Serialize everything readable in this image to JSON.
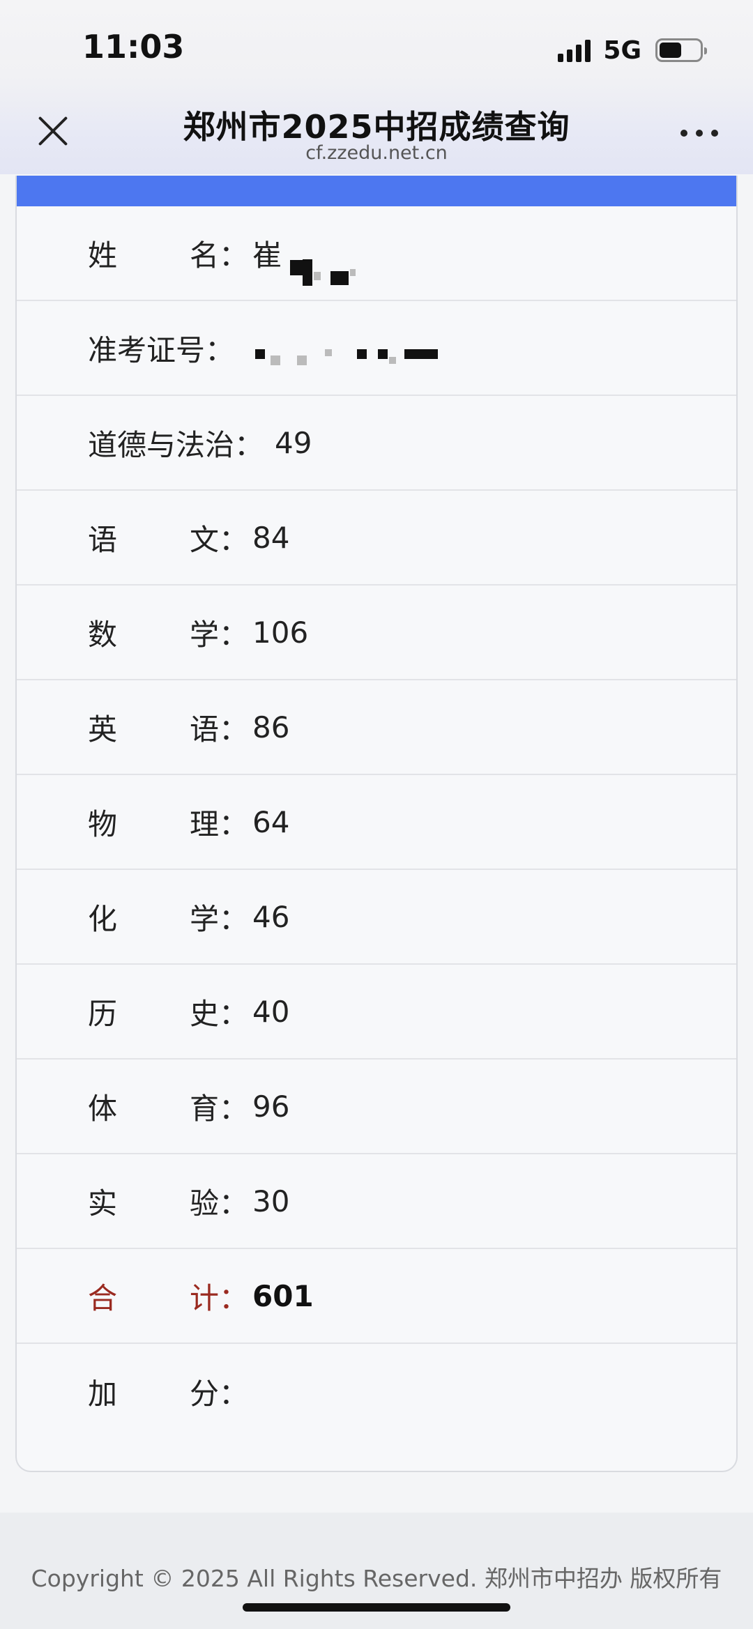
{
  "status_bar": {
    "time": "11:03",
    "network": "5G",
    "battery_level": 0.55
  },
  "nav": {
    "title": "郑州市2025中招成绩查询",
    "url": "cf.zzedu.net.cn"
  },
  "colors": {
    "accent_bar": "#4d77f0",
    "total_label": "#9a2a20"
  },
  "rows": [
    {
      "label_left": "姓",
      "label_right": "名：",
      "value": "崔"
    },
    {
      "label": "准考证号：",
      "value": ""
    },
    {
      "label": "道德与法治：",
      "value": "49"
    },
    {
      "label_left": "语",
      "label_right": "文：",
      "value": "84"
    },
    {
      "label_left": "数",
      "label_right": "学：",
      "value": "106"
    },
    {
      "label_left": "英",
      "label_right": "语：",
      "value": "86"
    },
    {
      "label_left": "物",
      "label_right": "理：",
      "value": "64"
    },
    {
      "label_left": "化",
      "label_right": "学：",
      "value": "46"
    },
    {
      "label_left": "历",
      "label_right": "史：",
      "value": "40"
    },
    {
      "label_left": "体",
      "label_right": "育：",
      "value": "96"
    },
    {
      "label_left": "实",
      "label_right": "验：",
      "value": "30"
    },
    {
      "label_left": "合",
      "label_right": "计：",
      "value": "601"
    },
    {
      "label_left": "加",
      "label_right": "分：",
      "value": ""
    }
  ],
  "footer": {
    "copyright": "Copyright © 2025 All Rights Reserved. 郑州市中招办 版权所有"
  }
}
